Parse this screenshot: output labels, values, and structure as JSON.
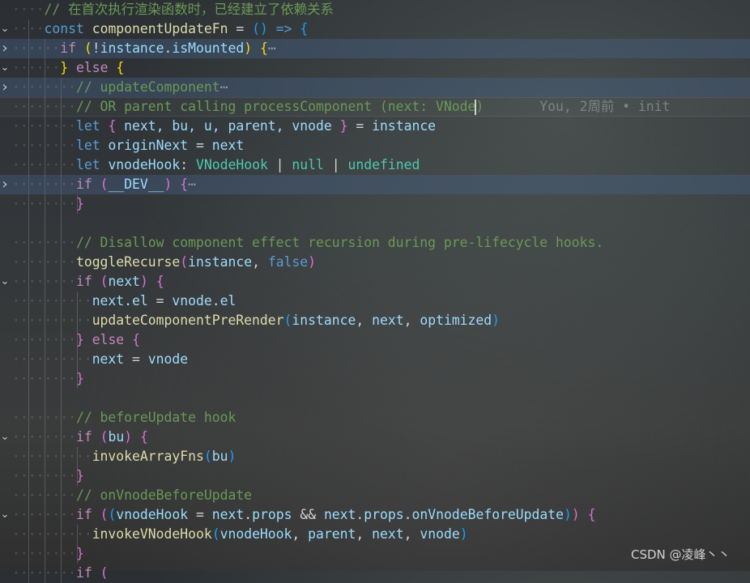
{
  "editor": {
    "lines": [
      {
        "indent": 4,
        "fold": "",
        "tokens": [
          [
            "// 在首次执行渲染函数时，已经建立了依赖关系",
            "c"
          ]
        ]
      },
      {
        "indent": 4,
        "fold": "expanded",
        "tokens": [
          [
            "const",
            "kw"
          ],
          [
            " ",
            "p"
          ],
          [
            "componentUpdateFn",
            "fn"
          ],
          [
            " = ",
            "op"
          ],
          [
            "()",
            "b3"
          ],
          [
            " => ",
            "kw"
          ],
          [
            "{",
            "b3"
          ]
        ]
      },
      {
        "indent": 6,
        "fold": "collapsed",
        "folded": true,
        "tokens": [
          [
            "if",
            "ctl"
          ],
          [
            " ",
            "p"
          ],
          [
            "(",
            "b1"
          ],
          [
            "!",
            "op"
          ],
          [
            "instance",
            "v"
          ],
          [
            ".",
            "p"
          ],
          [
            "isMounted",
            "v"
          ],
          [
            ")",
            "b1"
          ],
          [
            " ",
            "p"
          ],
          [
            "{",
            "b1"
          ],
          [
            "⋯",
            "dots"
          ]
        ]
      },
      {
        "indent": 6,
        "fold": "expanded",
        "tokens": [
          [
            "}",
            "b1"
          ],
          [
            " ",
            "p"
          ],
          [
            "else",
            "ctl"
          ],
          [
            " ",
            "p"
          ],
          [
            "{",
            "b1"
          ]
        ]
      },
      {
        "indent": 8,
        "fold": "collapsed",
        "folded": true,
        "tokens": [
          [
            "// updateComponent",
            "c"
          ],
          [
            "⋯",
            "dots"
          ]
        ]
      },
      {
        "indent": 8,
        "fold": "",
        "current": true,
        "tokens": [
          [
            "// OR parent calling processComponent (next: VNode",
            "c"
          ],
          [
            "|",
            "cursor"
          ],
          [
            ")",
            "c"
          ],
          [
            "       You, 2周前 • init",
            "blame"
          ]
        ]
      },
      {
        "indent": 8,
        "fold": "",
        "tokens": [
          [
            "let",
            "kw"
          ],
          [
            " ",
            "p"
          ],
          [
            "{",
            "b2"
          ],
          [
            " next, bu, u, parent, vnode ",
            "v"
          ],
          [
            "}",
            "b2"
          ],
          [
            " = ",
            "op"
          ],
          [
            "instance",
            "v"
          ]
        ]
      },
      {
        "indent": 8,
        "fold": "",
        "tokens": [
          [
            "let",
            "kw"
          ],
          [
            " ",
            "p"
          ],
          [
            "originNext",
            "v"
          ],
          [
            " = ",
            "op"
          ],
          [
            "next",
            "v"
          ]
        ]
      },
      {
        "indent": 8,
        "fold": "",
        "tokens": [
          [
            "let",
            "kw"
          ],
          [
            " ",
            "p"
          ],
          [
            "vnodeHook",
            "v"
          ],
          [
            ": ",
            "p"
          ],
          [
            "VNodeHook",
            "t"
          ],
          [
            " | ",
            "op"
          ],
          [
            "null",
            "t"
          ],
          [
            " | ",
            "op"
          ],
          [
            "undefined",
            "t"
          ]
        ]
      },
      {
        "indent": 8,
        "fold": "collapsed",
        "folded": true,
        "tokens": [
          [
            "if",
            "ctl"
          ],
          [
            " ",
            "p"
          ],
          [
            "(",
            "b2"
          ],
          [
            "__DEV__",
            "v"
          ],
          [
            ")",
            "b2"
          ],
          [
            " ",
            "p"
          ],
          [
            "{",
            "b2"
          ],
          [
            "⋯",
            "dots"
          ]
        ]
      },
      {
        "indent": 8,
        "fold": "",
        "tokens": [
          [
            "}",
            "b2"
          ]
        ]
      },
      {
        "indent": 0,
        "fold": "",
        "tokens": []
      },
      {
        "indent": 8,
        "fold": "",
        "tokens": [
          [
            "// Disallow component effect recursion during pre-lifecycle hooks.",
            "c"
          ]
        ]
      },
      {
        "indent": 8,
        "fold": "",
        "tokens": [
          [
            "toggleRecurse",
            "fn"
          ],
          [
            "(",
            "b2"
          ],
          [
            "instance",
            "v"
          ],
          [
            ", ",
            "p"
          ],
          [
            "false",
            "kw"
          ],
          [
            ")",
            "b2"
          ]
        ]
      },
      {
        "indent": 8,
        "fold": "expanded",
        "tokens": [
          [
            "if",
            "ctl"
          ],
          [
            " ",
            "p"
          ],
          [
            "(",
            "b2"
          ],
          [
            "next",
            "v"
          ],
          [
            ")",
            "b2"
          ],
          [
            " ",
            "p"
          ],
          [
            "{",
            "b2"
          ]
        ]
      },
      {
        "indent": 10,
        "fold": "",
        "tokens": [
          [
            "next",
            "v"
          ],
          [
            ".",
            "p"
          ],
          [
            "el",
            "v"
          ],
          [
            " = ",
            "op"
          ],
          [
            "vnode",
            "v"
          ],
          [
            ".",
            "p"
          ],
          [
            "el",
            "v"
          ]
        ]
      },
      {
        "indent": 10,
        "fold": "",
        "tokens": [
          [
            "updateComponentPreRender",
            "fn"
          ],
          [
            "(",
            "b3"
          ],
          [
            "instance",
            "v"
          ],
          [
            ", ",
            "p"
          ],
          [
            "next",
            "v"
          ],
          [
            ", ",
            "p"
          ],
          [
            "optimized",
            "v"
          ],
          [
            ")",
            "b3"
          ]
        ]
      },
      {
        "indent": 8,
        "fold": "",
        "tokens": [
          [
            "}",
            "b2"
          ],
          [
            " ",
            "p"
          ],
          [
            "else",
            "ctl"
          ],
          [
            " ",
            "p"
          ],
          [
            "{",
            "b2"
          ]
        ]
      },
      {
        "indent": 10,
        "fold": "",
        "tokens": [
          [
            "next",
            "v"
          ],
          [
            " = ",
            "op"
          ],
          [
            "vnode",
            "v"
          ]
        ]
      },
      {
        "indent": 8,
        "fold": "",
        "tokens": [
          [
            "}",
            "b2"
          ]
        ]
      },
      {
        "indent": 0,
        "fold": "",
        "tokens": []
      },
      {
        "indent": 8,
        "fold": "",
        "tokens": [
          [
            "// beforeUpdate hook",
            "c"
          ]
        ]
      },
      {
        "indent": 8,
        "fold": "expanded",
        "tokens": [
          [
            "if",
            "ctl"
          ],
          [
            " ",
            "p"
          ],
          [
            "(",
            "b2"
          ],
          [
            "bu",
            "v"
          ],
          [
            ")",
            "b2"
          ],
          [
            " ",
            "p"
          ],
          [
            "{",
            "b2"
          ]
        ]
      },
      {
        "indent": 10,
        "fold": "",
        "tokens": [
          [
            "invokeArrayFns",
            "fn"
          ],
          [
            "(",
            "b3"
          ],
          [
            "bu",
            "v"
          ],
          [
            ")",
            "b3"
          ]
        ]
      },
      {
        "indent": 8,
        "fold": "",
        "tokens": [
          [
            "}",
            "b2"
          ]
        ]
      },
      {
        "indent": 8,
        "fold": "",
        "tokens": [
          [
            "// onVnodeBeforeUpdate",
            "c"
          ]
        ]
      },
      {
        "indent": 8,
        "fold": "expanded",
        "tokens": [
          [
            "if",
            "ctl"
          ],
          [
            " ",
            "p"
          ],
          [
            "(",
            "b2"
          ],
          [
            "(",
            "b3"
          ],
          [
            "vnodeHook",
            "v"
          ],
          [
            " = ",
            "op"
          ],
          [
            "next",
            "v"
          ],
          [
            ".",
            "p"
          ],
          [
            "props",
            "v"
          ],
          [
            " && ",
            "op"
          ],
          [
            "next",
            "v"
          ],
          [
            ".",
            "p"
          ],
          [
            "props",
            "v"
          ],
          [
            ".",
            "p"
          ],
          [
            "onVnodeBeforeUpdate",
            "v"
          ],
          [
            ")",
            "b3"
          ],
          [
            ")",
            "b2"
          ],
          [
            " ",
            "p"
          ],
          [
            "{",
            "b2"
          ]
        ]
      },
      {
        "indent": 10,
        "fold": "",
        "tokens": [
          [
            "invokeVNodeHook",
            "fn"
          ],
          [
            "(",
            "b3"
          ],
          [
            "vnodeHook",
            "v"
          ],
          [
            ", ",
            "p"
          ],
          [
            "parent",
            "v"
          ],
          [
            ", ",
            "p"
          ],
          [
            "next",
            "v"
          ],
          [
            ", ",
            "p"
          ],
          [
            "vnode",
            "v"
          ],
          [
            ")",
            "b3"
          ]
        ]
      },
      {
        "indent": 8,
        "fold": "",
        "tokens": [
          [
            "}",
            "b2"
          ]
        ]
      },
      {
        "indent": 8,
        "fold": "",
        "tokens": [
          [
            "if",
            "ctl"
          ],
          [
            " ",
            "p"
          ],
          [
            "(",
            "b2"
          ]
        ]
      }
    ]
  },
  "icons": {
    "expanded": "chevron-down-icon",
    "collapsed": "chevron-right-icon"
  },
  "watermark": "CSDN @凌峰丶丶"
}
